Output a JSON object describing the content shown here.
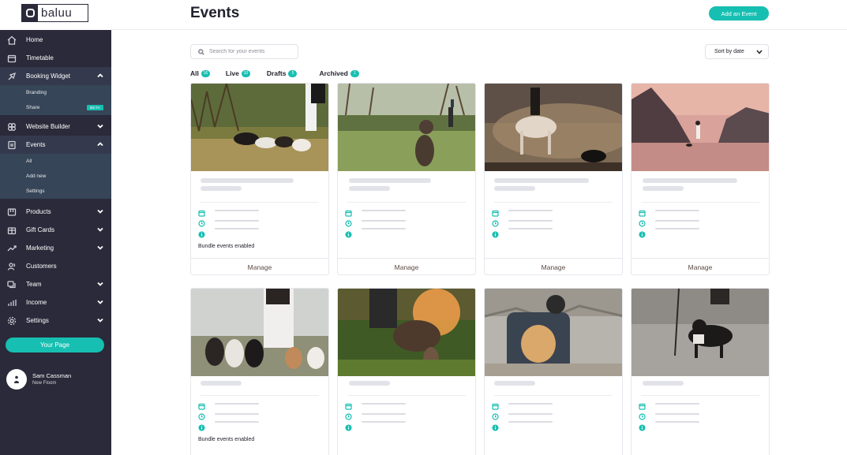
{
  "brand": {
    "name": "baluu"
  },
  "sidebar": {
    "items": [
      {
        "label": "Home",
        "icon": "home-icon"
      },
      {
        "label": "Timetable",
        "icon": "calendar-icon"
      },
      {
        "label": "Booking Widget",
        "icon": "brush-icon",
        "expanded": true,
        "children": [
          {
            "label": "Branding"
          },
          {
            "label": "Share",
            "badge": "BETA"
          }
        ]
      },
      {
        "label": "Website Builder",
        "icon": "layout-icon"
      },
      {
        "label": "Events",
        "icon": "document-icon",
        "expanded": true,
        "children": [
          {
            "label": "All"
          },
          {
            "label": "Add new"
          },
          {
            "label": "Settings"
          }
        ]
      },
      {
        "label": "Products",
        "icon": "box-icon"
      },
      {
        "label": "Gift Cards",
        "icon": "gift-icon"
      },
      {
        "label": "Marketing",
        "icon": "trend-icon"
      },
      {
        "label": "Customers",
        "icon": "users-icon"
      },
      {
        "label": "Team",
        "icon": "team-icon"
      },
      {
        "label": "Income",
        "icon": "bars-icon"
      },
      {
        "label": "Settings",
        "icon": "gear-icon"
      }
    ],
    "your_page": "Your Page",
    "user": {
      "name": "Sam Cassman",
      "sub": "New Floom"
    }
  },
  "header": {
    "title": "Events",
    "add_button": "Add an Event"
  },
  "toolbar": {
    "search_placeholder": "Search for your events",
    "sort_label": "Sort by date"
  },
  "tabs": [
    {
      "label": "All",
      "count": "16"
    },
    {
      "label": "Live",
      "count": "10"
    },
    {
      "label": "Drafts",
      "count": "5"
    },
    {
      "label": "Archived",
      "count": "1"
    }
  ],
  "cards": [
    {
      "image": "dogs-walking-field",
      "bundle": "Bundle events enabled",
      "action": "Manage"
    },
    {
      "image": "dog-sitting-park",
      "bundle": "",
      "action": "Manage"
    },
    {
      "image": "horse-rider-dog",
      "bundle": "",
      "action": "Manage"
    },
    {
      "image": "beach-sunset-dog",
      "bundle": "",
      "action": "Manage"
    },
    {
      "image": "dog-walker-pack",
      "bundle": "Bundle events enabled",
      "action": "Manage"
    },
    {
      "image": "dog-sunset-grass",
      "bundle": "",
      "action": "Manage"
    },
    {
      "image": "dog-in-backpack",
      "bundle": "",
      "action": "Manage"
    },
    {
      "image": "dog-on-beach",
      "bundle": "",
      "action": "Manage"
    }
  ],
  "colors": {
    "accent": "#16bfb1",
    "sidebar": "#2a2a3a",
    "subnav": "#364557"
  }
}
